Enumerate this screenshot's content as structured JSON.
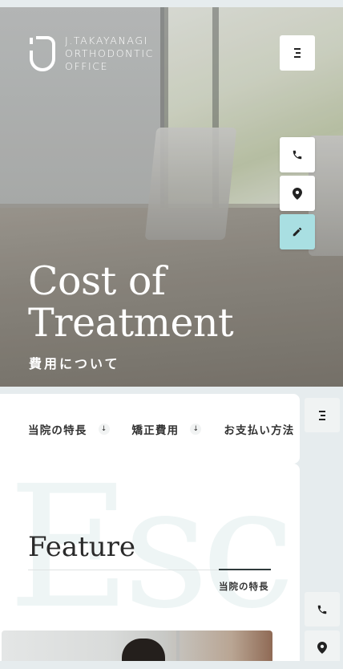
{
  "header": {
    "logo_line1": "J.TAKAYANAGI",
    "logo_line2": "ORTHODONTIC",
    "logo_line3": "OFFICE"
  },
  "hero": {
    "title_line1": "Cost of",
    "title_line2": "Treatment",
    "subtitle": "費用について"
  },
  "actions": {
    "menu_icon": "menu-icon",
    "phone_icon": "phone-icon",
    "map_icon": "map-pin-icon",
    "edit_icon": "pencil-icon",
    "accent_color": "#a9dfe2"
  },
  "nav": {
    "items": [
      {
        "label": "当院の特長",
        "icon": "arrow-down-icon"
      },
      {
        "label": "矯正費用",
        "icon": "arrow-down-icon"
      },
      {
        "label": "お支払い方法"
      }
    ]
  },
  "section": {
    "bg_text": "Esc",
    "title": "Feature",
    "subtitle": "当院の特長"
  }
}
